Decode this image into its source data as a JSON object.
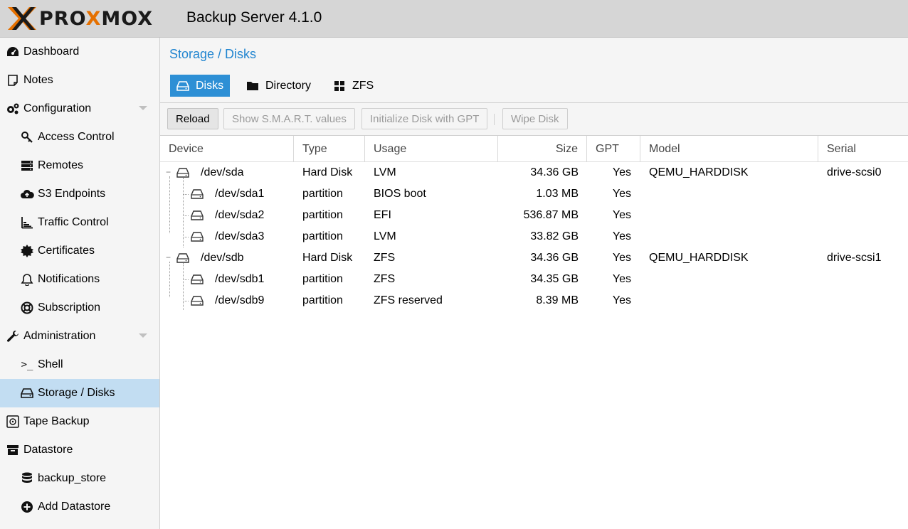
{
  "header": {
    "logo": "PROXMOX",
    "app_title": "Backup Server 4.1.0"
  },
  "sidebar": {
    "items": [
      {
        "label": "Dashboard",
        "icon": "dashboard-icon"
      },
      {
        "label": "Notes",
        "icon": "notes-icon"
      },
      {
        "label": "Configuration",
        "icon": "gears-icon"
      },
      {
        "label": "Access Control",
        "icon": "key-icon"
      },
      {
        "label": "Remotes",
        "icon": "server-icon"
      },
      {
        "label": "S3 Endpoints",
        "icon": "cloud-upload-icon"
      },
      {
        "label": "Traffic Control",
        "icon": "bar-chart-icon"
      },
      {
        "label": "Certificates",
        "icon": "certificate-icon"
      },
      {
        "label": "Notifications",
        "icon": "bell-icon"
      },
      {
        "label": "Subscription",
        "icon": "life-ring-icon"
      },
      {
        "label": "Administration",
        "icon": "wrench-icon"
      },
      {
        "label": "Shell",
        "icon": "terminal-icon"
      },
      {
        "label": "Storage / Disks",
        "icon": "hdd-icon"
      },
      {
        "label": "Tape Backup",
        "icon": "tape-icon"
      },
      {
        "label": "Datastore",
        "icon": "archive-icon"
      },
      {
        "label": "backup_store",
        "icon": "database-icon"
      },
      {
        "label": "Add Datastore",
        "icon": "plus-circle-icon"
      }
    ]
  },
  "main": {
    "breadcrumb": "Storage / Disks",
    "tabs": [
      {
        "label": "Disks",
        "icon": "hdd-icon"
      },
      {
        "label": "Directory",
        "icon": "folder-icon"
      },
      {
        "label": "ZFS",
        "icon": "grid-icon"
      }
    ],
    "toolbar": {
      "reload": "Reload",
      "smart": "Show S.M.A.R.T. values",
      "init_gpt": "Initialize Disk with GPT",
      "wipe": "Wipe Disk"
    },
    "columns": [
      "Device",
      "Type",
      "Usage",
      "Size",
      "GPT",
      "Model",
      "Serial"
    ],
    "rows": [
      {
        "device": "/dev/sda",
        "type": "Hard Disk",
        "usage": "LVM",
        "size": "34.36 GB",
        "gpt": "Yes",
        "model": "QEMU_HARDDISK",
        "serial": "drive-scsi0"
      },
      {
        "device": "/dev/sda1",
        "type": "partition",
        "usage": "BIOS boot",
        "size": "1.03 MB",
        "gpt": "Yes",
        "model": "",
        "serial": ""
      },
      {
        "device": "/dev/sda2",
        "type": "partition",
        "usage": "EFI",
        "size": "536.87 MB",
        "gpt": "Yes",
        "model": "",
        "serial": ""
      },
      {
        "device": "/dev/sda3",
        "type": "partition",
        "usage": "LVM",
        "size": "33.82 GB",
        "gpt": "Yes",
        "model": "",
        "serial": ""
      },
      {
        "device": "/dev/sdb",
        "type": "Hard Disk",
        "usage": "ZFS",
        "size": "34.36 GB",
        "gpt": "Yes",
        "model": "QEMU_HARDDISK",
        "serial": "drive-scsi1"
      },
      {
        "device": "/dev/sdb1",
        "type": "partition",
        "usage": "ZFS",
        "size": "34.35 GB",
        "gpt": "Yes",
        "model": "",
        "serial": ""
      },
      {
        "device": "/dev/sdb9",
        "type": "partition",
        "usage": "ZFS reserved",
        "size": "8.39 MB",
        "gpt": "Yes",
        "model": "",
        "serial": ""
      }
    ]
  },
  "colors": {
    "accent": "#2d8fd5",
    "selected_bg": "#c2ddf2",
    "logo_orange": "#e57000"
  }
}
